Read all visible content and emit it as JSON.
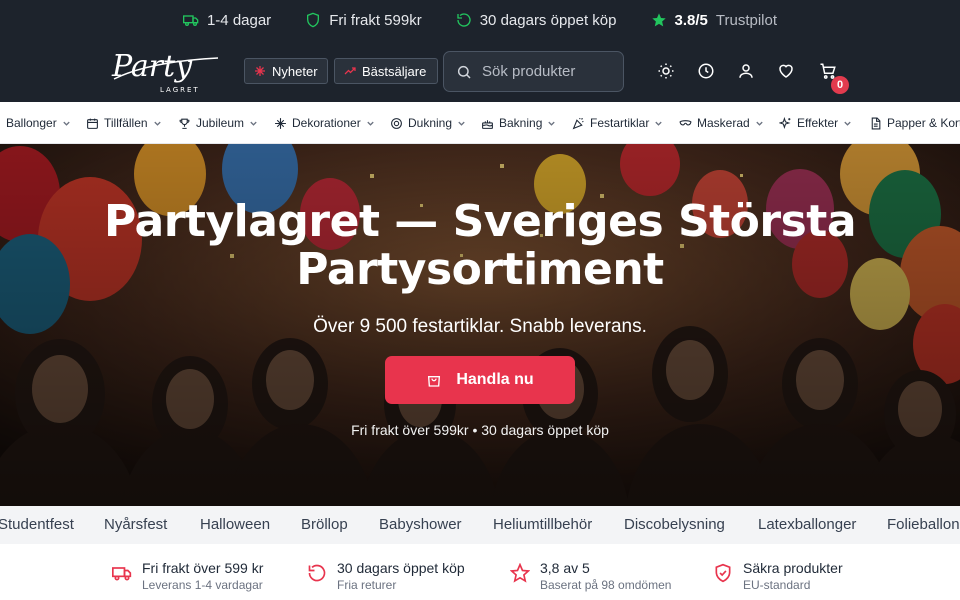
{
  "topbar": {
    "delivery": "1-4 dagar",
    "free_shipping": "Fri frakt 599kr",
    "returns": "30 dagars öppet köp",
    "rating": "3.8/5",
    "rating_source": "Trustpilot"
  },
  "header": {
    "logo_text": "Party",
    "logo_sub": "LAGRET",
    "news_label": "Nyheter",
    "bestsellers_label": "Bästsäljare",
    "search_placeholder": "Sök produkter",
    "cart_count": "0"
  },
  "categories": [
    "Ballonger",
    "Tillfällen",
    "Jubileum",
    "Dekorationer",
    "Dukning",
    "Bakning",
    "Festartiklar",
    "Maskerad",
    "Effekter",
    "Papper & Kort"
  ],
  "hero": {
    "title_line1": "Partylagret — Sveriges Största",
    "title_line2": "Partysortiment",
    "subtitle": "Över 9 500 festartiklar. Snabb leverans.",
    "cta": "Handla nu",
    "tagline": "Fri frakt över 599kr • 30 dagars öppet köp"
  },
  "occasions": [
    "Studentfest",
    "Nyårsfest",
    "Halloween",
    "Bröllop",
    "Babyshower",
    "Heliumtillbehör",
    "Discobelysning",
    "Latexballonger",
    "Folieballonger"
  ],
  "usps": [
    {
      "title": "Fri frakt över 599 kr",
      "sub": "Leverans 1-4 vardagar",
      "icon": "truck-icon"
    },
    {
      "title": "30 dagars öppet köp",
      "sub": "Fria returer",
      "icon": "return-icon"
    },
    {
      "title": "3,8 av 5",
      "sub": "Baserat på 98 omdömen",
      "icon": "star-icon"
    },
    {
      "title": "Säkra produkter",
      "sub": "EU-standard",
      "icon": "shield-icon"
    }
  ],
  "colors": {
    "header_bg": "#1d232c",
    "accent": "#e8344d",
    "green": "#22c55e"
  }
}
